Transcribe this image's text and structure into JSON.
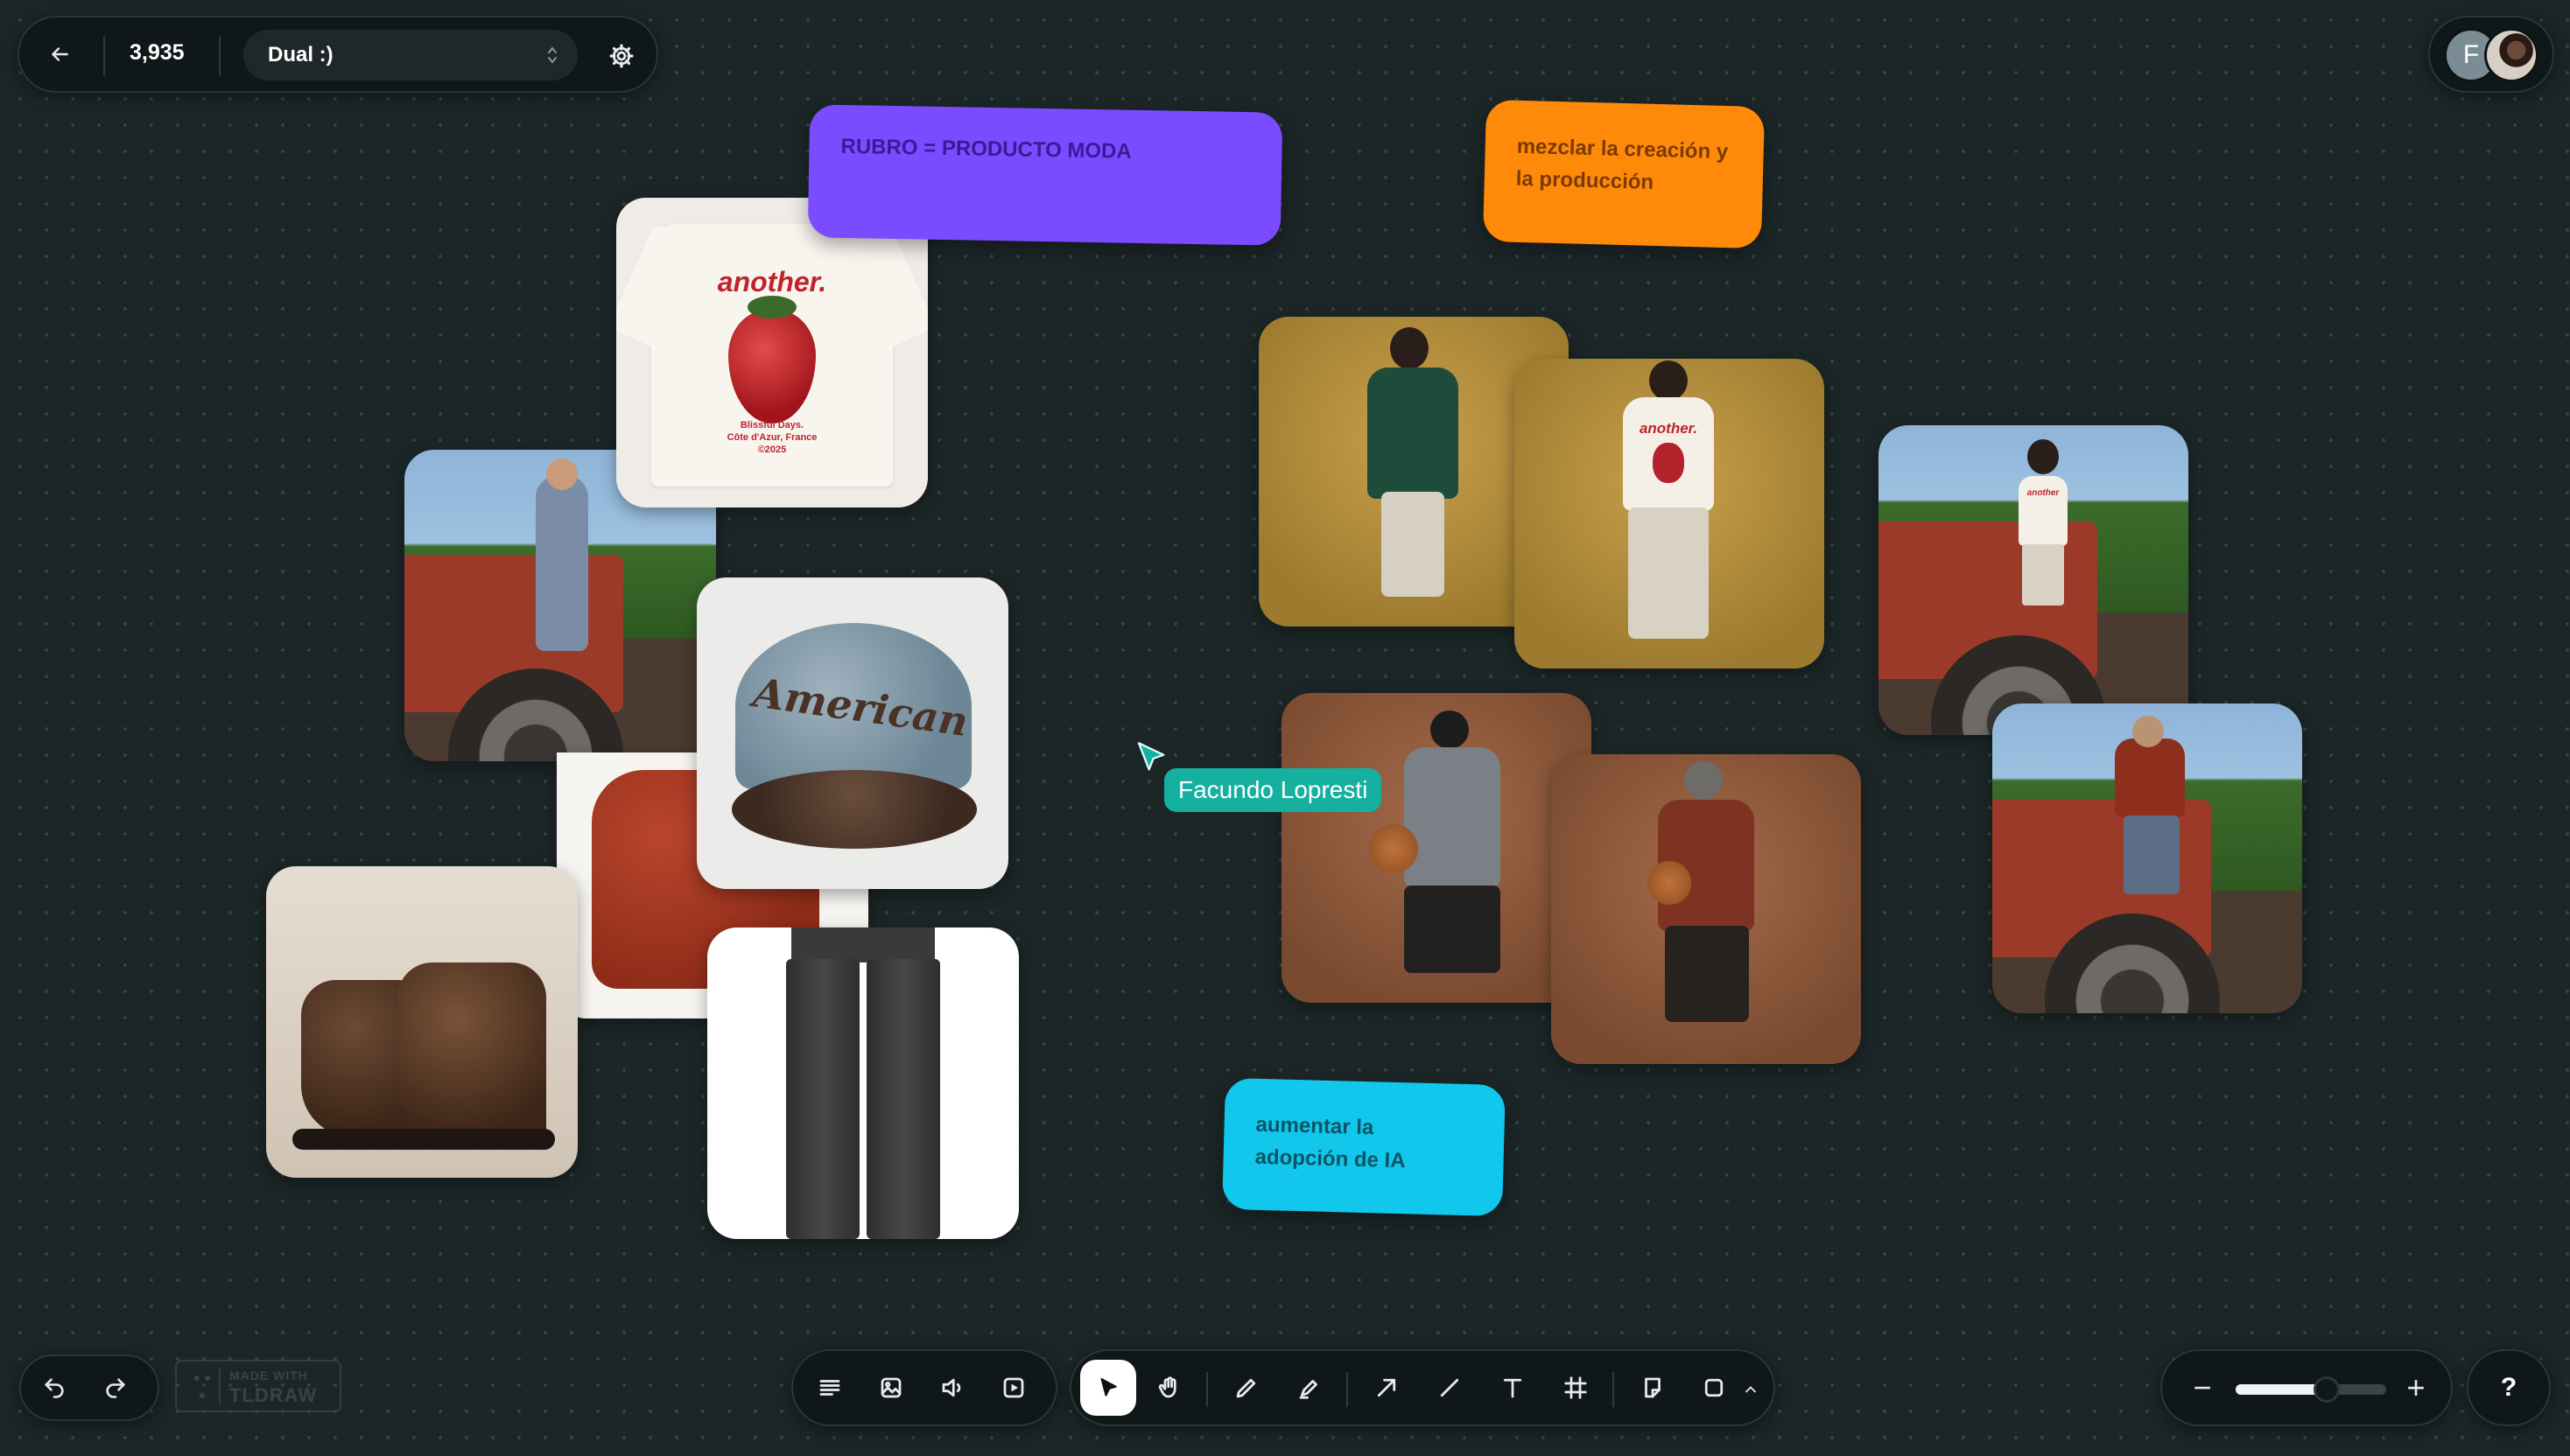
{
  "toolbar_top": {
    "back_icon": "arrow-left-icon",
    "count": "3,935",
    "board_name": "Dual :)",
    "settings_icon": "gear-icon"
  },
  "users": {
    "avatar_letter": "F",
    "avatar_photo": "user-photo"
  },
  "stickies": [
    {
      "text": "RUBRO = PRODUCTO MODA",
      "color": "#7b4cff",
      "text_color": "#3a1a9a"
    },
    {
      "text": "mezclar la creación y la producción",
      "color": "#ff8a0a",
      "text_color": "#7a3a00"
    },
    {
      "text": "aumentar la adopción de IA",
      "color": "#11c7ec",
      "text_color": "#0b5566"
    }
  ],
  "images": {
    "tshirt": {
      "brand": "another.",
      "caption_line1": "Blissful Days.",
      "caption_line2": "Côte d'Azur, France",
      "caption_line3": "©2025"
    },
    "cap": {
      "text": "American"
    },
    "tshirt_model": {
      "brand": "another."
    },
    "tractor_model": {
      "brand": "another"
    }
  },
  "cursor": {
    "user_name": "Facundo Lopresti",
    "color": "#16b0a0"
  },
  "bottom_left": {
    "undo_icon": "undo-icon",
    "redo_icon": "redo-icon",
    "watermark_line1": "MADE WITH",
    "watermark_line2": "TLDRAW"
  },
  "tools": {
    "group1": [
      "text-menu-icon",
      "image-icon",
      "audio-icon",
      "video-icon"
    ],
    "group2": [
      "select-icon",
      "hand-icon",
      "pencil-icon",
      "highlighter-icon",
      "arrow-icon",
      "line-icon",
      "text-icon",
      "frame-icon",
      "sticky-note-icon",
      "rectangle-icon",
      "chevron-up-icon"
    ]
  },
  "zoom": {
    "minus": "−",
    "plus": "+",
    "level": 0.6
  },
  "help": "?"
}
